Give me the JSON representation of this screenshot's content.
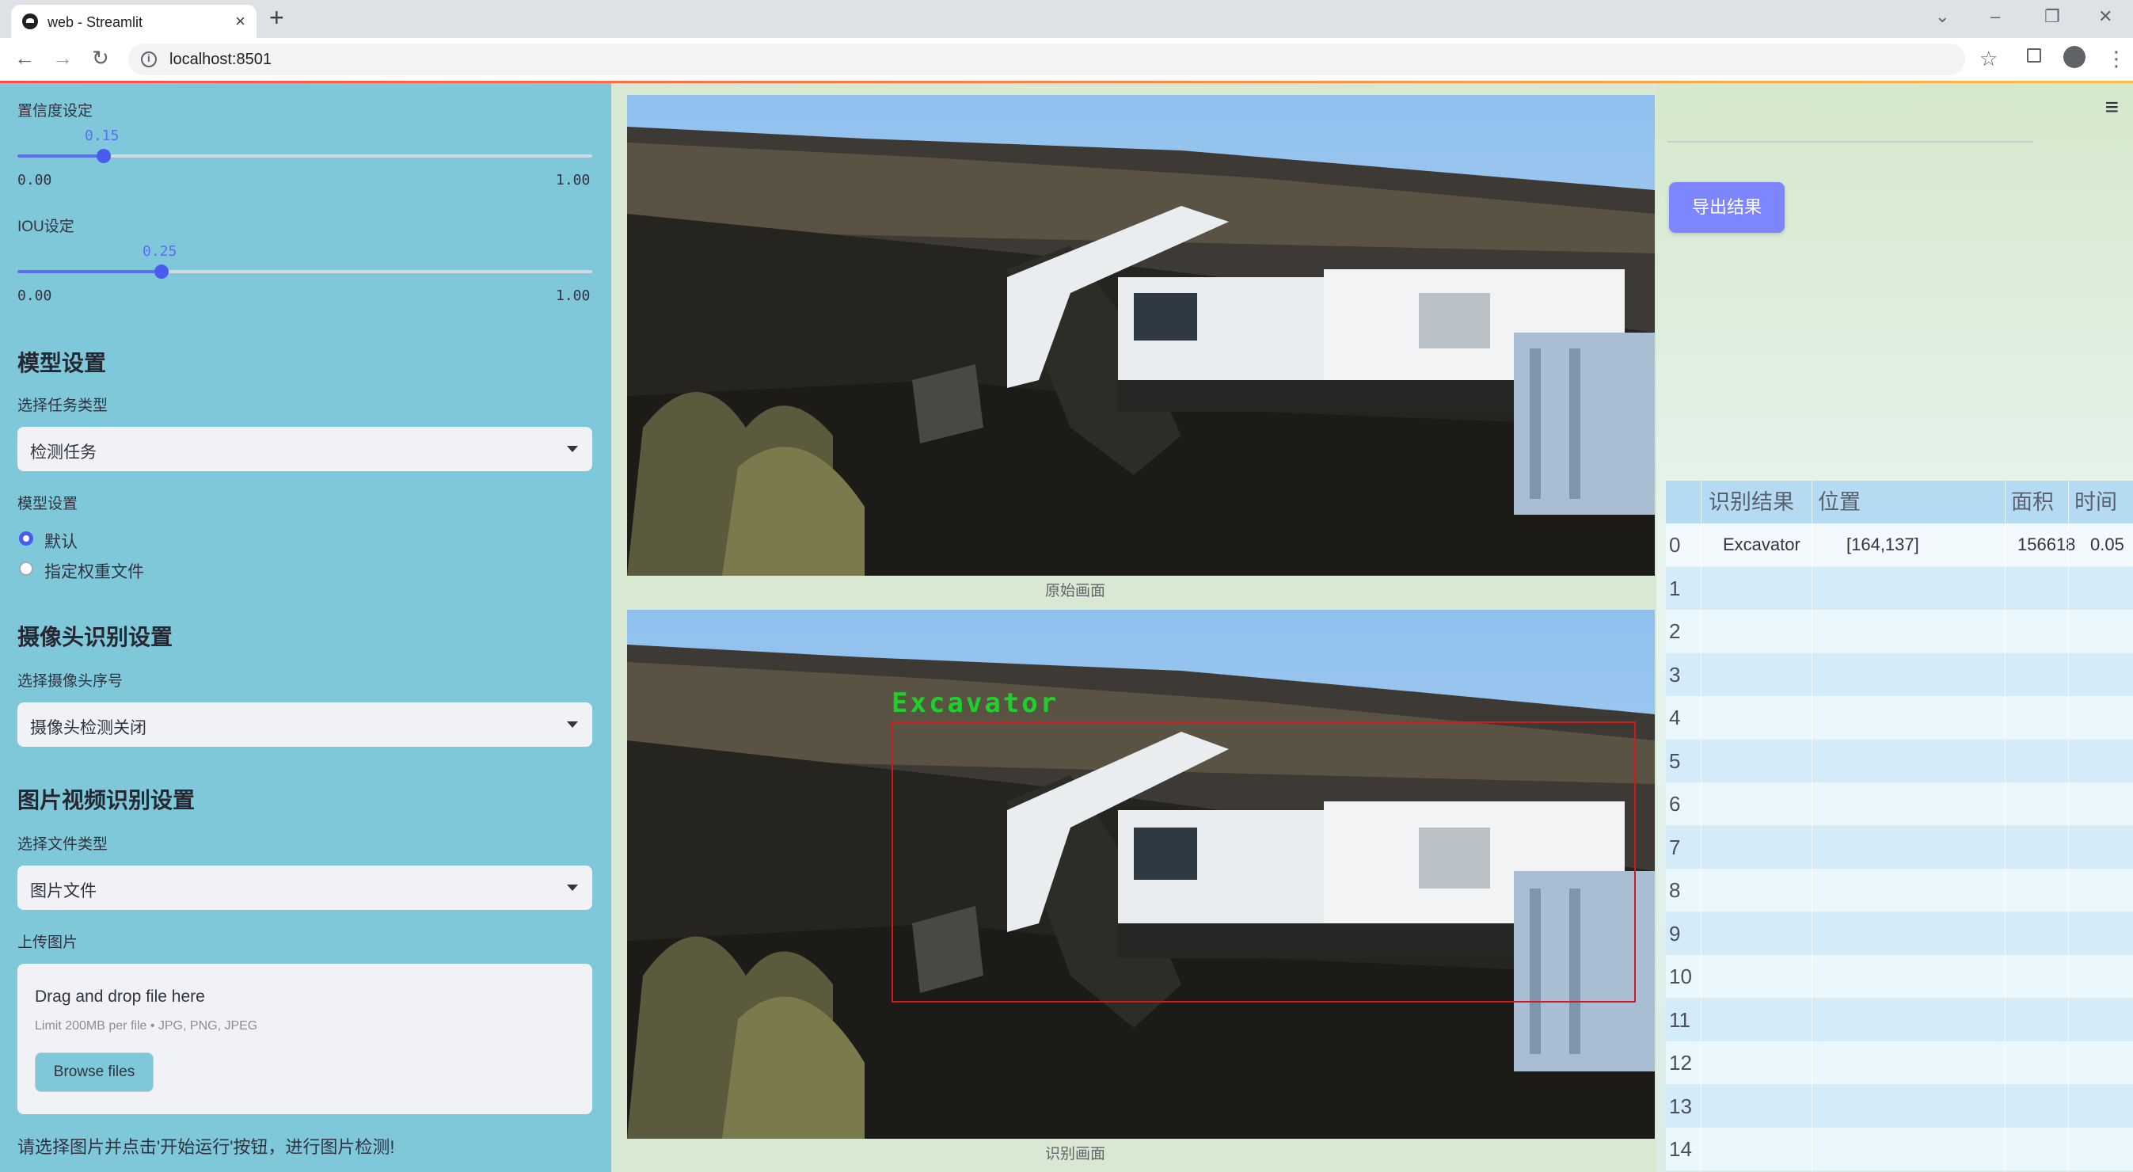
{
  "browser": {
    "tab_title": "web - Streamlit",
    "url": "localhost:8501"
  },
  "sidebar": {
    "confidence": {
      "label": "置信度设定",
      "value": 0.15,
      "value_text": "0.15",
      "min_text": "0.00",
      "max_text": "1.00"
    },
    "iou": {
      "label": "IOU设定",
      "value": 0.25,
      "value_text": "0.25",
      "min_text": "0.00",
      "max_text": "1.00"
    },
    "model_header": "模型设置",
    "task_label": "选择任务类型",
    "task_value": "检测任务",
    "model_label": "模型设置",
    "model_options": [
      {
        "label": "默认",
        "checked": true
      },
      {
        "label": "指定权重文件",
        "checked": false
      }
    ],
    "camera_header": "摄像头识别设置",
    "camera_label": "选择摄像头序号",
    "camera_value": "摄像头检测关闭",
    "file_header": "图片视频识别设置",
    "file_type_label": "选择文件类型",
    "file_type_value": "图片文件",
    "upload_label": "上传图片",
    "drop_title": "Drag and drop file here",
    "drop_limit": "Limit 200MB per file • JPG, PNG, JPEG",
    "browse_label": "Browse files",
    "note": "请选择图片并点击'开始运行'按钮，进行图片检测!"
  },
  "main": {
    "original_caption": "原始画面",
    "result_caption": "识别画面",
    "detection_label": "Excavator",
    "export_label": "导出结果",
    "table": {
      "columns": [
        "识别结果",
        "位置",
        "面积",
        "时间"
      ],
      "rows": [
        {
          "index": "0",
          "result": "Excavator",
          "position": "[164,137]",
          "area": "156618",
          "time": "0.05"
        },
        {
          "index": "1",
          "result": "",
          "position": "",
          "area": "",
          "time": ""
        },
        {
          "index": "2",
          "result": "",
          "position": "",
          "area": "",
          "time": ""
        },
        {
          "index": "3",
          "result": "",
          "position": "",
          "area": "",
          "time": ""
        },
        {
          "index": "4",
          "result": "",
          "position": "",
          "area": "",
          "time": ""
        },
        {
          "index": "5",
          "result": "",
          "position": "",
          "area": "",
          "time": ""
        },
        {
          "index": "6",
          "result": "",
          "position": "",
          "area": "",
          "time": ""
        },
        {
          "index": "7",
          "result": "",
          "position": "",
          "area": "",
          "time": ""
        },
        {
          "index": "8",
          "result": "",
          "position": "",
          "area": "",
          "time": ""
        },
        {
          "index": "9",
          "result": "",
          "position": "",
          "area": "",
          "time": ""
        },
        {
          "index": "10",
          "result": "",
          "position": "",
          "area": "",
          "time": ""
        },
        {
          "index": "11",
          "result": "",
          "position": "",
          "area": "",
          "time": ""
        },
        {
          "index": "12",
          "result": "",
          "position": "",
          "area": "",
          "time": ""
        },
        {
          "index": "13",
          "result": "",
          "position": "",
          "area": "",
          "time": ""
        },
        {
          "index": "14",
          "result": "",
          "position": "",
          "area": "",
          "time": ""
        }
      ]
    }
  },
  "icons": {
    "back": "←",
    "forward": "→",
    "reload": "↻",
    "star": "☆",
    "menu": "≡",
    "kebab": "⋮"
  }
}
